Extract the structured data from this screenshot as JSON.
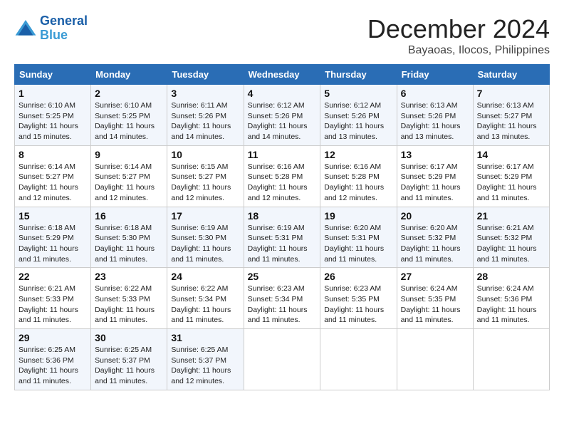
{
  "header": {
    "logo_line1": "General",
    "logo_line2": "Blue",
    "month": "December 2024",
    "location": "Bayaoas, Ilocos, Philippines"
  },
  "days_of_week": [
    "Sunday",
    "Monday",
    "Tuesday",
    "Wednesday",
    "Thursday",
    "Friday",
    "Saturday"
  ],
  "weeks": [
    [
      {
        "day": "1",
        "sunrise": "6:10 AM",
        "sunset": "5:25 PM",
        "daylight": "11 hours and 15 minutes."
      },
      {
        "day": "2",
        "sunrise": "6:10 AM",
        "sunset": "5:25 PM",
        "daylight": "11 hours and 14 minutes."
      },
      {
        "day": "3",
        "sunrise": "6:11 AM",
        "sunset": "5:26 PM",
        "daylight": "11 hours and 14 minutes."
      },
      {
        "day": "4",
        "sunrise": "6:12 AM",
        "sunset": "5:26 PM",
        "daylight": "11 hours and 14 minutes."
      },
      {
        "day": "5",
        "sunrise": "6:12 AM",
        "sunset": "5:26 PM",
        "daylight": "11 hours and 13 minutes."
      },
      {
        "day": "6",
        "sunrise": "6:13 AM",
        "sunset": "5:26 PM",
        "daylight": "11 hours and 13 minutes."
      },
      {
        "day": "7",
        "sunrise": "6:13 AM",
        "sunset": "5:27 PM",
        "daylight": "11 hours and 13 minutes."
      }
    ],
    [
      {
        "day": "8",
        "sunrise": "6:14 AM",
        "sunset": "5:27 PM",
        "daylight": "11 hours and 12 minutes."
      },
      {
        "day": "9",
        "sunrise": "6:14 AM",
        "sunset": "5:27 PM",
        "daylight": "11 hours and 12 minutes."
      },
      {
        "day": "10",
        "sunrise": "6:15 AM",
        "sunset": "5:27 PM",
        "daylight": "11 hours and 12 minutes."
      },
      {
        "day": "11",
        "sunrise": "6:16 AM",
        "sunset": "5:28 PM",
        "daylight": "11 hours and 12 minutes."
      },
      {
        "day": "12",
        "sunrise": "6:16 AM",
        "sunset": "5:28 PM",
        "daylight": "11 hours and 12 minutes."
      },
      {
        "day": "13",
        "sunrise": "6:17 AM",
        "sunset": "5:29 PM",
        "daylight": "11 hours and 11 minutes."
      },
      {
        "day": "14",
        "sunrise": "6:17 AM",
        "sunset": "5:29 PM",
        "daylight": "11 hours and 11 minutes."
      }
    ],
    [
      {
        "day": "15",
        "sunrise": "6:18 AM",
        "sunset": "5:29 PM",
        "daylight": "11 hours and 11 minutes."
      },
      {
        "day": "16",
        "sunrise": "6:18 AM",
        "sunset": "5:30 PM",
        "daylight": "11 hours and 11 minutes."
      },
      {
        "day": "17",
        "sunrise": "6:19 AM",
        "sunset": "5:30 PM",
        "daylight": "11 hours and 11 minutes."
      },
      {
        "day": "18",
        "sunrise": "6:19 AM",
        "sunset": "5:31 PM",
        "daylight": "11 hours and 11 minutes."
      },
      {
        "day": "19",
        "sunrise": "6:20 AM",
        "sunset": "5:31 PM",
        "daylight": "11 hours and 11 minutes."
      },
      {
        "day": "20",
        "sunrise": "6:20 AM",
        "sunset": "5:32 PM",
        "daylight": "11 hours and 11 minutes."
      },
      {
        "day": "21",
        "sunrise": "6:21 AM",
        "sunset": "5:32 PM",
        "daylight": "11 hours and 11 minutes."
      }
    ],
    [
      {
        "day": "22",
        "sunrise": "6:21 AM",
        "sunset": "5:33 PM",
        "daylight": "11 hours and 11 minutes."
      },
      {
        "day": "23",
        "sunrise": "6:22 AM",
        "sunset": "5:33 PM",
        "daylight": "11 hours and 11 minutes."
      },
      {
        "day": "24",
        "sunrise": "6:22 AM",
        "sunset": "5:34 PM",
        "daylight": "11 hours and 11 minutes."
      },
      {
        "day": "25",
        "sunrise": "6:23 AM",
        "sunset": "5:34 PM",
        "daylight": "11 hours and 11 minutes."
      },
      {
        "day": "26",
        "sunrise": "6:23 AM",
        "sunset": "5:35 PM",
        "daylight": "11 hours and 11 minutes."
      },
      {
        "day": "27",
        "sunrise": "6:24 AM",
        "sunset": "5:35 PM",
        "daylight": "11 hours and 11 minutes."
      },
      {
        "day": "28",
        "sunrise": "6:24 AM",
        "sunset": "5:36 PM",
        "daylight": "11 hours and 11 minutes."
      }
    ],
    [
      {
        "day": "29",
        "sunrise": "6:25 AM",
        "sunset": "5:36 PM",
        "daylight": "11 hours and 11 minutes."
      },
      {
        "day": "30",
        "sunrise": "6:25 AM",
        "sunset": "5:37 PM",
        "daylight": "11 hours and 11 minutes."
      },
      {
        "day": "31",
        "sunrise": "6:25 AM",
        "sunset": "5:37 PM",
        "daylight": "11 hours and 12 minutes."
      },
      null,
      null,
      null,
      null
    ]
  ]
}
